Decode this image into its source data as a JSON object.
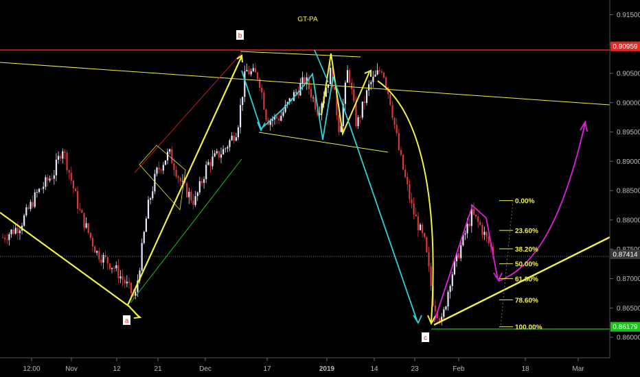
{
  "chart_data": {
    "type": "candlestick",
    "title": "GT-PA",
    "x_ticks": [
      "12:00",
      "Nov",
      "12",
      "21",
      "Dec",
      "17",
      "2019",
      "14",
      "23",
      "Feb",
      "18",
      "Mar"
    ],
    "y_ticks": [
      "0.91500",
      "0.91000",
      "0.90500",
      "0.90000",
      "0.89500",
      "0.89000",
      "0.88500",
      "0.88000",
      "0.87500",
      "0.87000",
      "0.86500",
      "0.86000"
    ],
    "ylim": [
      0.8565,
      0.9175
    ],
    "price_labels": [
      {
        "value": 0.90959,
        "text": "0.90959",
        "color": "#e8261f"
      },
      {
        "value": 0.87414,
        "text": "0.87414",
        "color": "#3a3a3a"
      },
      {
        "value": 0.86179,
        "text": "0.86179",
        "color": "#1fbf1f"
      }
    ],
    "wave_labels": [
      "a",
      "b",
      "c"
    ],
    "fibonacci": {
      "levels": [
        "0.00%",
        "23.60%",
        "38.20%",
        "50.00%",
        "61.80%",
        "78.60%",
        "100.00%"
      ],
      "high": 0.8833,
      "low": 0.86179
    },
    "price_path": [
      [
        0,
        0.877
      ],
      [
        4,
        0.879
      ],
      [
        8,
        0.8845
      ],
      [
        12,
        0.888
      ],
      [
        14,
        0.8925
      ],
      [
        18,
        0.8815
      ],
      [
        22,
        0.8745
      ],
      [
        26,
        0.872
      ],
      [
        29,
        0.869
      ],
      [
        31,
        0.8665
      ],
      [
        34,
        0.882
      ],
      [
        36,
        0.888
      ],
      [
        39,
        0.8915
      ],
      [
        42,
        0.886
      ],
      [
        45,
        0.883
      ],
      [
        48,
        0.8895
      ],
      [
        52,
        0.892
      ],
      [
        55,
        0.8955
      ],
      [
        57,
        0.9055
      ],
      [
        60,
        0.9045
      ],
      [
        62,
        0.897
      ],
      [
        65,
        0.8975
      ],
      [
        68,
        0.901
      ],
      [
        71,
        0.904
      ],
      [
        74,
        0.8985
      ],
      [
        77,
        0.9055
      ],
      [
        79,
        0.895
      ],
      [
        81,
        0.906
      ],
      [
        83,
        0.896
      ],
      [
        86,
        0.903
      ],
      [
        89,
        0.906
      ],
      [
        91,
        0.9
      ],
      [
        93,
        0.8915
      ],
      [
        96,
        0.882
      ],
      [
        99,
        0.876
      ],
      [
        101,
        0.866
      ],
      [
        103,
        0.8625
      ],
      [
        105,
        0.87
      ],
      [
        107,
        0.8745
      ],
      [
        110,
        0.881
      ],
      [
        112,
        0.879
      ],
      [
        115,
        0.8745
      ]
    ],
    "colors": {
      "background": "#000000",
      "up_candle": "#e8e8ff",
      "down_candle": "#d83a3a",
      "resistance": "#e8261f",
      "trendline": "#f2f246",
      "support": "#1fbf1f",
      "wave_cyan": "#2fd4d4",
      "projection": "#e020e0"
    }
  }
}
